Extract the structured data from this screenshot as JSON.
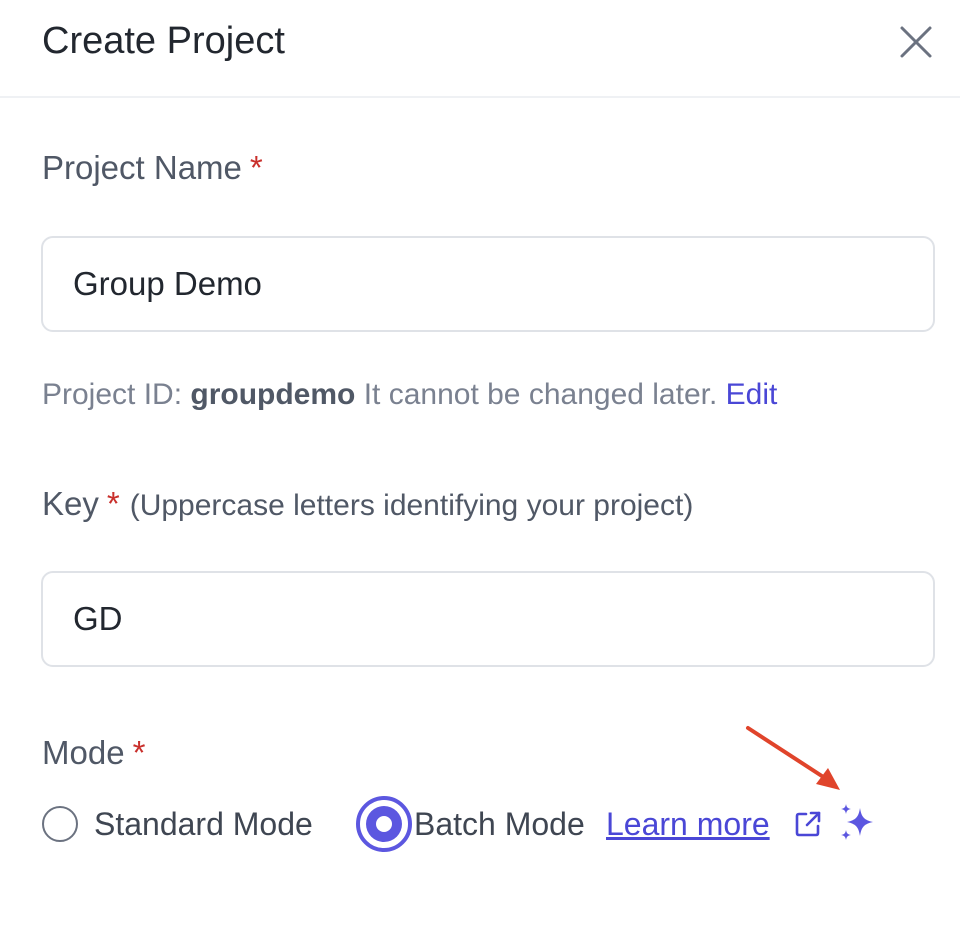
{
  "dialog": {
    "title": "Create Project",
    "close_icon": "close-icon"
  },
  "project_name": {
    "label": "Project Name",
    "required_mark": "*",
    "value": "Group Demo"
  },
  "project_id_help": {
    "prefix": "Project ID: ",
    "id": "groupdemo",
    "note": " It cannot be changed later. ",
    "edit_label": "Edit"
  },
  "key": {
    "label": "Key",
    "required_mark": "*",
    "hint": "(Uppercase letters identifying your project)",
    "value": "GD"
  },
  "mode": {
    "label": "Mode",
    "required_mark": "*",
    "options": [
      {
        "label": "Standard Mode",
        "selected": false
      },
      {
        "label": "Batch Mode",
        "selected": true
      }
    ],
    "learn_more_label": "Learn more",
    "external_link_icon": "external-link-icon",
    "sparkle_icon": "sparkle-icon"
  },
  "colors": {
    "accent": "#5c57e0",
    "link": "#4a47d6",
    "required": "#c9302c",
    "annotation_arrow": "#e0442b"
  }
}
